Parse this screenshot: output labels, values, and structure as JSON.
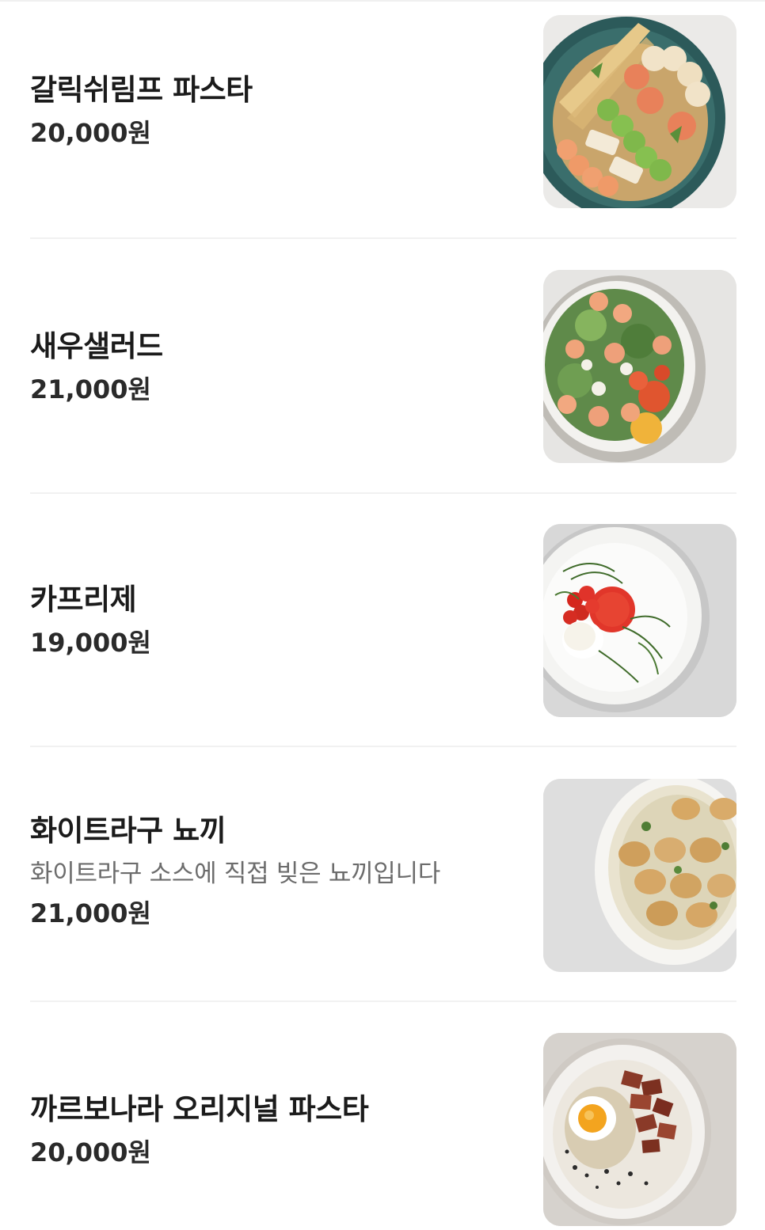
{
  "menu": {
    "items": [
      {
        "name": "갈릭쉬림프 파스타",
        "description": "",
        "price": "20,000원",
        "photo": "garlic-shrimp-pasta-photo"
      },
      {
        "name": "새우샐러드",
        "description": "",
        "price": "21,000원",
        "photo": "shrimp-salad-photo"
      },
      {
        "name": "카프리제",
        "description": "",
        "price": "19,000원",
        "photo": "caprese-photo"
      },
      {
        "name": "화이트라구 뇨끼",
        "description": "화이트라구 소스에 직접 빚은 뇨끼입니다",
        "price": "21,000원",
        "photo": "white-ragu-gnocchi-photo"
      },
      {
        "name": "까르보나라 오리지널 파스타",
        "description": "",
        "price": "20,000원",
        "photo": "carbonara-original-pasta-photo"
      }
    ]
  },
  "colors": {
    "name_text": "#1b1b1b",
    "description_text": "#6c6c6c",
    "price_text": "#2a2a2a",
    "divider": "#f1f1f1",
    "background": "#ffffff"
  }
}
